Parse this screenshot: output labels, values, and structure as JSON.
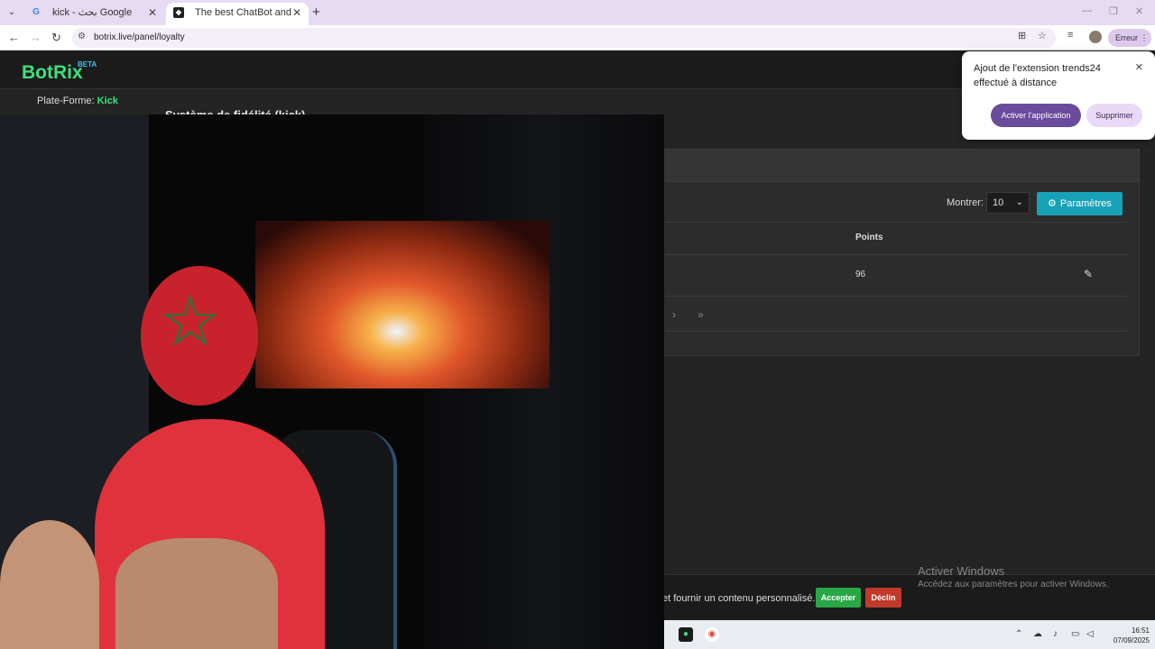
{
  "browser": {
    "tabs": [
      {
        "title": "kick - بحث Google",
        "active": false,
        "favicon": "google-icon"
      },
      {
        "title": "The best ChatBot and Widgets",
        "active": true,
        "favicon": "botrix-icon"
      }
    ],
    "url": "botrix.live/panel/loyalty",
    "profile_button": "Erreur"
  },
  "app": {
    "logo": "BotRix",
    "badge": "BETA",
    "platform_label": "Plate-Forme:",
    "platform_value": "Kick",
    "page_title": "Système de fidélité (kick)"
  },
  "table": {
    "show_label": "Montrer:",
    "page_size": "10",
    "settings_button": "Paramètres",
    "columns": [
      "Points"
    ],
    "rows": [
      {
        "points": "96"
      }
    ]
  },
  "extension_popup": {
    "message": "Ajout de l'extension trends24 effectué à distance",
    "activate_button": "Activer l'application",
    "remove_button": "Supprimer"
  },
  "cookie_banner": {
    "text": "et fournir un contenu personnalisé.",
    "accept_button": "Accepter",
    "decline_button": "Déclin"
  },
  "windows_watermark": {
    "title": "Activer Windows",
    "subtitle": "Accédez aux paramètres pour activer Windows."
  },
  "taskbar": {
    "time": "16:51",
    "date": "07/09/2025"
  },
  "colors": {
    "accent_green": "#3ee07a",
    "info_blue": "#17a2b8",
    "extension_purple": "#6a4b9c"
  }
}
